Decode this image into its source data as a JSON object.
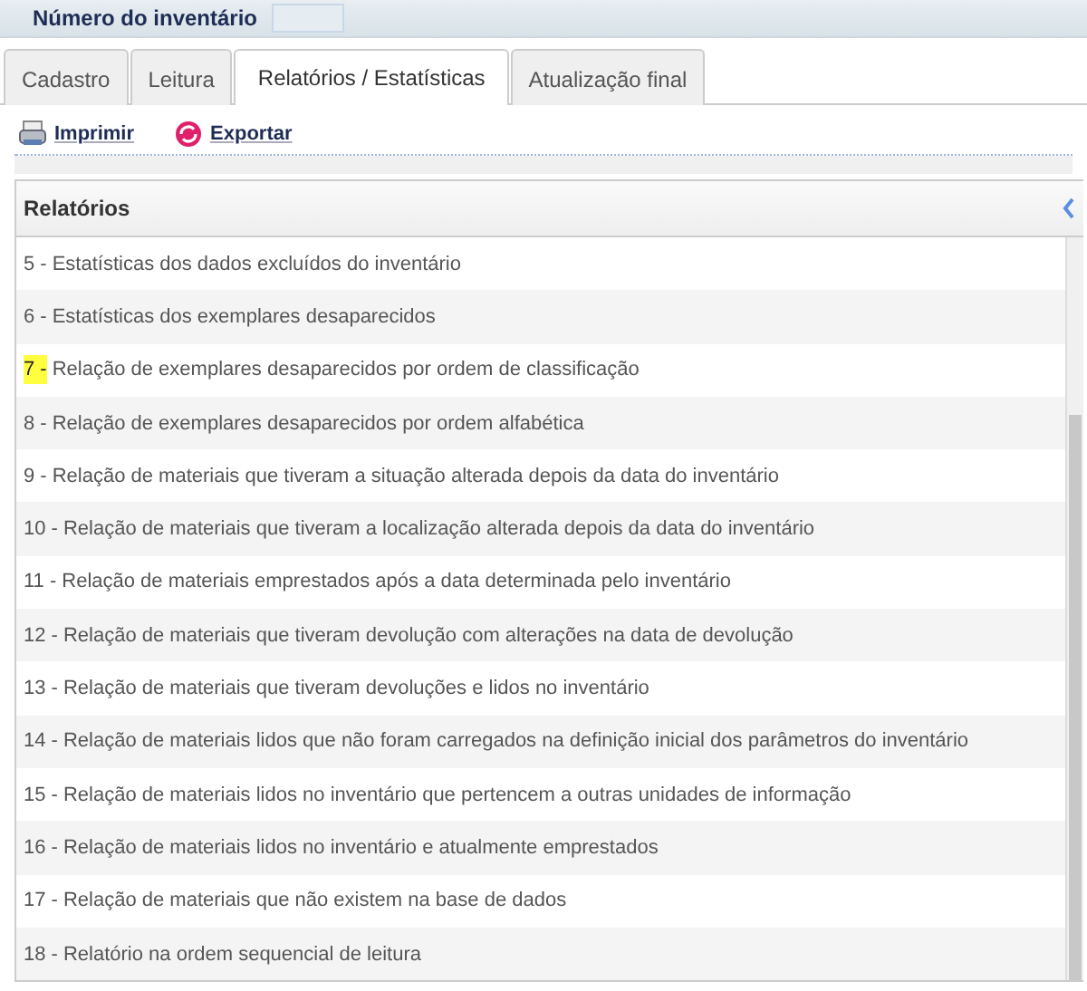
{
  "header": {
    "label": "Número do inventário"
  },
  "tabs": [
    {
      "label": "Cadastro",
      "selected": false
    },
    {
      "label": "Leitura",
      "selected": false
    },
    {
      "label": "Relatórios / Estatísticas",
      "selected": true
    },
    {
      "label": "Atualização final",
      "selected": false
    }
  ],
  "toolbar": [
    {
      "label": "Imprimir",
      "kind": "print"
    },
    {
      "label": "Exportar",
      "kind": "export"
    }
  ],
  "panel": {
    "title": "Relatórios",
    "items": [
      {
        "number": "5 -",
        "text": "Estatísticas dos dados excluídos do inventário",
        "highlighted": false
      },
      {
        "number": "6 -",
        "text": "Estatísticas dos exemplares desaparecidos",
        "highlighted": false
      },
      {
        "number": "7 -",
        "text": "Relação de exemplares desaparecidos por ordem de classificação",
        "highlighted": true
      },
      {
        "number": "8 -",
        "text": "Relação de exemplares desaparecidos por ordem alfabética",
        "highlighted": false
      },
      {
        "number": "9 -",
        "text": "Relação de materiais que tiveram a situação alterada depois da data do inventário",
        "highlighted": false
      },
      {
        "number": "10 -",
        "text": "Relação de materiais que tiveram a localização alterada depois da data do inventário",
        "highlighted": false
      },
      {
        "number": "11 -",
        "text": "Relação de materiais emprestados após a data determinada pelo inventário",
        "highlighted": false
      },
      {
        "number": "12 -",
        "text": "Relação de materiais que tiveram devolução com alterações na data de devolução",
        "highlighted": false
      },
      {
        "number": "13 -",
        "text": "Relação de materiais que tiveram devoluções e lidos no inventário",
        "highlighted": false
      },
      {
        "number": "14 -",
        "text": "Relação de materiais lidos que não foram carregados na definição inicial dos parâmetros do inventário",
        "highlighted": false
      },
      {
        "number": "15 -",
        "text": "Relação de materiais lidos no inventário que pertencem a outras unidades de informação",
        "highlighted": false
      },
      {
        "number": "16 -",
        "text": "Relação de materiais lidos no inventário e atualmente emprestados",
        "highlighted": false
      },
      {
        "number": "17 -",
        "text": "Relação de materiais que não existem na base de dados",
        "highlighted": false
      },
      {
        "number": "18 -",
        "text": "Relatório na ordem sequencial de leitura",
        "highlighted": false
      }
    ]
  }
}
